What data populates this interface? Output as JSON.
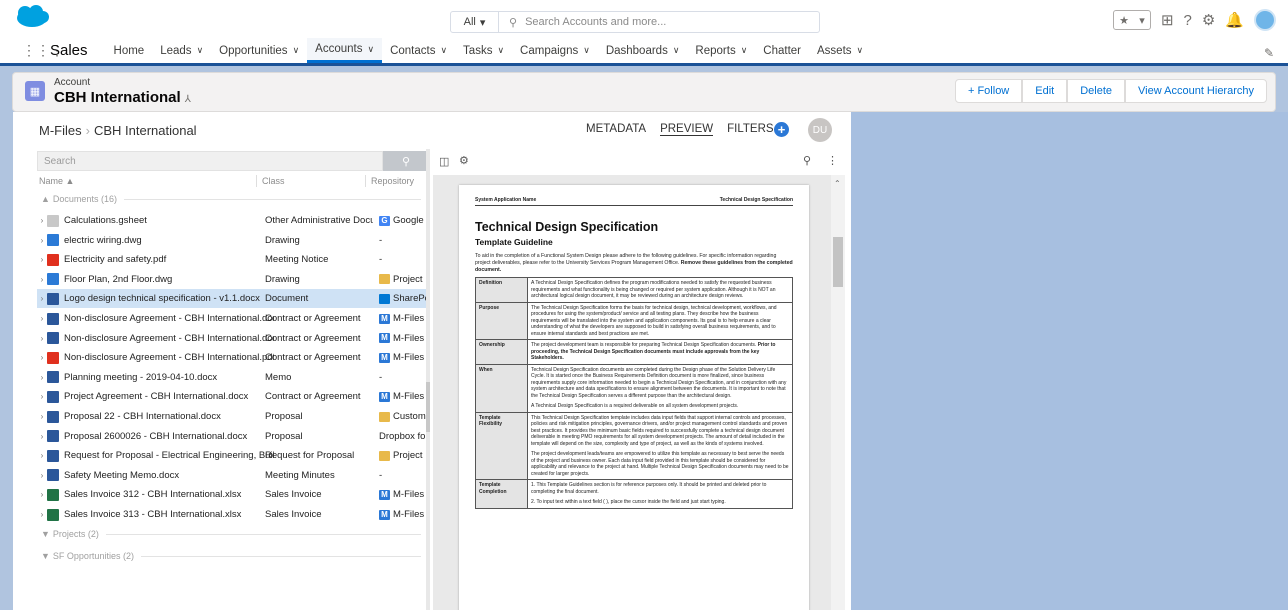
{
  "topbar": {
    "search_scope": "All",
    "search_placeholder": "Search Accounts and more..."
  },
  "nav": {
    "app_name": "Sales",
    "items": [
      {
        "label": "Home",
        "dropdown": false
      },
      {
        "label": "Leads",
        "dropdown": true
      },
      {
        "label": "Opportunities",
        "dropdown": true
      },
      {
        "label": "Accounts",
        "dropdown": true,
        "active": true
      },
      {
        "label": "Contacts",
        "dropdown": true
      },
      {
        "label": "Tasks",
        "dropdown": true
      },
      {
        "label": "Campaigns",
        "dropdown": true
      },
      {
        "label": "Dashboards",
        "dropdown": true
      },
      {
        "label": "Reports",
        "dropdown": true
      },
      {
        "label": "Chatter",
        "dropdown": false
      },
      {
        "label": "Assets",
        "dropdown": true
      }
    ]
  },
  "record": {
    "type": "Account",
    "name": "CBH International",
    "actions": [
      "+ Follow",
      "Edit",
      "Delete",
      "View Account Hierarchy"
    ]
  },
  "mfiles": {
    "breadcrumb": [
      "M-Files",
      "CBH International"
    ],
    "tabs": [
      "METADATA",
      "PREVIEW",
      "FILTERS"
    ],
    "active_tab": "PREVIEW",
    "user_initials": "DU",
    "search_placeholder": "Search",
    "columns": [
      "Name ▲",
      "Class",
      "Repository"
    ],
    "groups": [
      "Documents (16)",
      "Projects (2)",
      "SF Opportunities (2)"
    ],
    "rows": [
      {
        "name": "Calculations.gsheet",
        "class": "Other Administrative Docu...",
        "repo": "Google Driv",
        "icon": "gsheet",
        "repo_icon": "google"
      },
      {
        "name": "electric wiring.dwg",
        "class": "Drawing",
        "repo": "-",
        "icon": "dwg",
        "repo_icon": ""
      },
      {
        "name": "Electricity and safety.pdf",
        "class": "Meeting Notice",
        "repo": "-",
        "icon": "pdf",
        "repo_icon": ""
      },
      {
        "name": "Floor Plan, 2nd Floor.dwg",
        "class": "Drawing",
        "repo": "Project Data",
        "icon": "dwg",
        "repo_icon": "folder"
      },
      {
        "name": "Logo design technical specification - v1.1.docx",
        "class": "Document",
        "repo": "SharePoint",
        "icon": "docx",
        "repo_icon": "sharepoint",
        "selected": true
      },
      {
        "name": "Non-disclosure Agreement - CBH International.docx",
        "class": "Contract or Agreement",
        "repo": "M-Files",
        "icon": "docx-link",
        "repo_icon": "mfiles"
      },
      {
        "name": "Non-disclosure Agreement - CBH International.docx",
        "class": "Contract or Agreement",
        "repo": "M-Files",
        "icon": "docx-link",
        "repo_icon": "mfiles"
      },
      {
        "name": "Non-disclosure Agreement - CBH International.pdf",
        "class": "Contract or Agreement",
        "repo": "M-Files",
        "icon": "pdf",
        "repo_icon": "mfiles"
      },
      {
        "name": "Planning meeting - 2019-04-10.docx",
        "class": "Memo",
        "repo": "-",
        "icon": "docx",
        "repo_icon": ""
      },
      {
        "name": "Project Agreement - CBH International.docx",
        "class": "Contract or Agreement",
        "repo": "M-Files",
        "icon": "docx",
        "repo_icon": "mfiles"
      },
      {
        "name": "Proposal 22 - CBH International.docx",
        "class": "Proposal",
        "repo": "Customer D",
        "icon": "docx",
        "repo_icon": "folder"
      },
      {
        "name": "Proposal 2600026 - CBH International.docx",
        "class": "Proposal",
        "repo": "Dropbox for Bu",
        "icon": "docx",
        "repo_icon": ""
      },
      {
        "name": "Request for Proposal - Electrical Engineering, Buildi...",
        "class": "Request for Proposal",
        "repo": "Project Data",
        "icon": "docx",
        "repo_icon": "folder"
      },
      {
        "name": "Safety Meeting Memo.docx",
        "class": "Meeting Minutes",
        "repo": "-",
        "icon": "docx",
        "repo_icon": ""
      },
      {
        "name": "Sales Invoice 312 - CBH International.xlsx",
        "class": "Sales Invoice",
        "repo": "M-Files",
        "icon": "xlsx",
        "repo_icon": "mfiles"
      },
      {
        "name": "Sales Invoice 313 - CBH International.xlsx",
        "class": "Sales Invoice",
        "repo": "M-Files",
        "icon": "xlsx",
        "repo_icon": "mfiles"
      }
    ]
  },
  "document": {
    "header_left": "System Application Name",
    "header_right": "Technical Design Specification",
    "title": "Technical Design Specification",
    "subtitle": "Template Guideline",
    "intro": "To aid in the completion of a Functional System Design please adhere to the following guidelines. For specific information regarding project deliverables, please refer to the University Services Program Management Office.",
    "intro_bold": "Remove these guidelines from the completed document.",
    "sections": [
      {
        "key": "Definition",
        "text": "A Technical Design Specification defines the program modifications needed to satisfy the requested business requirements and what functionality is being changed or required per system application. Although it is NOT an architectural logical design document, it may be reviewed during an architecture design reviews."
      },
      {
        "key": "Purpose",
        "text": "The Technical Design Specification forms the basis for technical design, technical development, workflows, and procedures for using the system/product/ service and all testing plans. They describe how the business requirements will be translated into the system and application components. Its goal is to help ensure a clear understanding of what the developers are supposed to build in satisfying overall business requirements, and to ensure internal standards and best practices are met."
      },
      {
        "key": "Ownership",
        "text": "The project development team is responsible for preparing Technical Design Specification documents.",
        "bold": "Prior to proceeding, the Technical Design Specification documents must include approvals from the key Stakeholders."
      },
      {
        "key": "When",
        "text": "Technical Design Specification documents are completed during the Design phase of the Solution Delivery Life Cycle. It is started once the Business Requirements Definition document is more finalized, since business requirements supply core information needed to begin a Technical Design Specification, and in conjunction with any system architecture and data specifications to ensure alignment between the documents. It is important to note that the Technical Design Specification serves a different purpose than the architectural design.",
        "extra": "A Technical Design Specification is a required deliverable on all system development projects."
      },
      {
        "key": "Template Flexibility",
        "text": "This Technical Design Specification template includes data input fields that support internal controls and processes, policies and risk mitigation principles, governance drivers, and/or project management control standards and proven best practices. It provides the minimum basic fields required to successfully complete a technical design document deliverable in meeting PMO requirements for all system development projects. The amount of detail included in the template will depend on the size, complexity and type of project, as well as the kinds of systems involved.",
        "extra": "The project development leads/teams are empowered to utilize this template as necessary to best serve the needs of the project and business owner. Each data input field provided in this template should be considered for applicability and relevance to the project at hand. Multiple Technical Design Specification documents may need to be created for larger projects."
      },
      {
        "key": "Template Completion",
        "text": "1. This Template Guidelines section is for reference purposes only. It should be printed and deleted prior to completing the final document.",
        "extra": "2. To input text within a text field ( ), place the cursor inside the field and just start typing."
      }
    ]
  },
  "colors": {
    "brand": "#00a1e0",
    "nav_accent": "#0070d2",
    "selected_row": "#cfe2f5",
    "background": "#b0c4df"
  }
}
